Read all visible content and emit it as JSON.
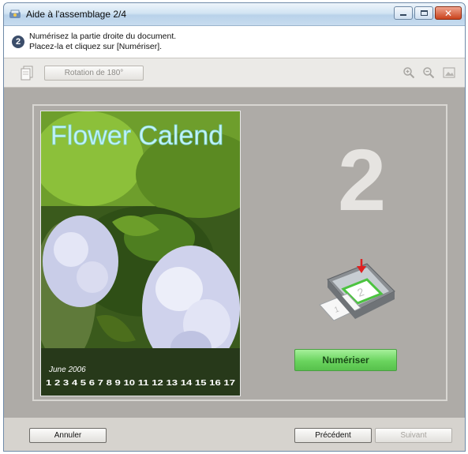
{
  "window": {
    "title": "Aide à l'assemblage 2/4",
    "close_glyph": "✕"
  },
  "instruction": {
    "step": "2",
    "line1": "Numérisez la partie droite du document.",
    "line2": "Placez-la et cliquez sur [Numériser]."
  },
  "toolbar": {
    "rotate_label": "Rotation de 180°",
    "icons": [
      "document-stack-icon",
      "zoom-in-icon",
      "zoom-out-icon",
      "fit-page-icon"
    ]
  },
  "preview": {
    "photo_title": "Flower Calend",
    "photo_month": "June 2006",
    "photo_dates": "1 2 3 4 5 6 7 8 9 10 11 12 13 14 15 16 17",
    "page_number": "2",
    "scan_label": "Numériser"
  },
  "footer": {
    "cancel_label": "Annuler",
    "prev_label": "Précédent",
    "next_label": "Suivant"
  },
  "colors": {
    "accent_green": "#6ad45e",
    "preview_bg": "#aeaba7"
  }
}
